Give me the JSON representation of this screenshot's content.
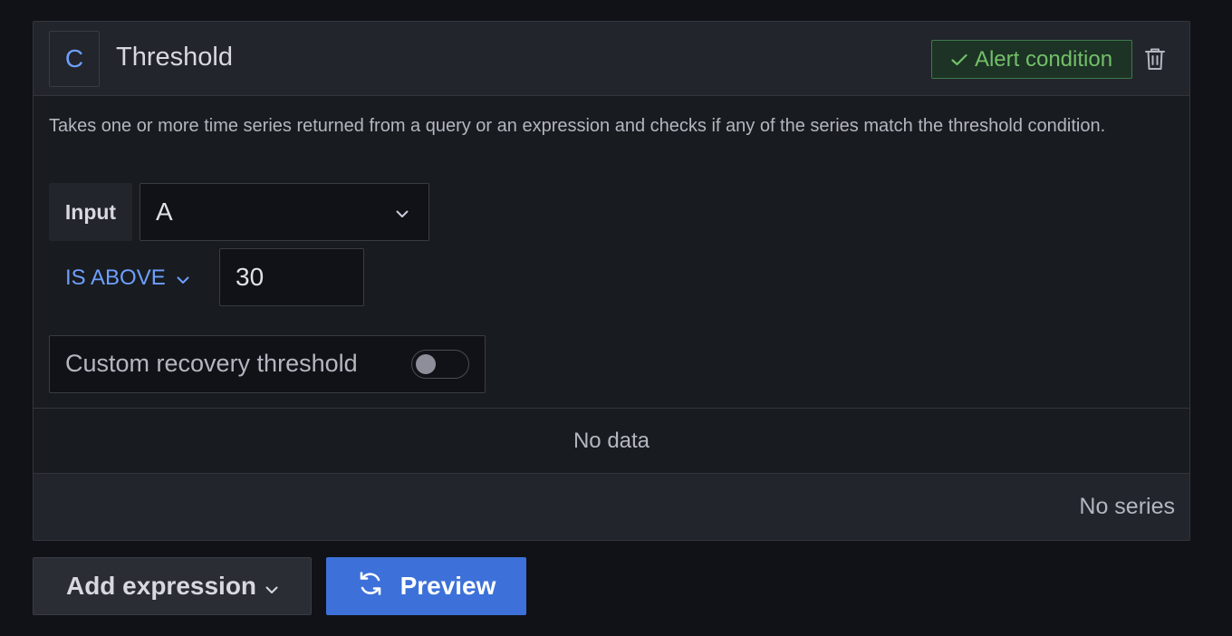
{
  "expression": {
    "ref_id": "C",
    "title": "Threshold",
    "alert_condition_label": "Alert condition",
    "description": "Takes one or more time series returned from a query or an expression and checks if any of the series match the threshold condition.",
    "input_label": "Input",
    "input_value": "A",
    "operator_label": "IS ABOVE",
    "threshold_value": "30",
    "custom_recovery_label": "Custom recovery threshold",
    "custom_recovery_enabled": false
  },
  "results": {
    "no_data_text": "No data",
    "no_series_text": "No series"
  },
  "actions": {
    "add_expression_label": "Add expression",
    "preview_label": "Preview"
  },
  "icons": {
    "check": "check-icon",
    "trash": "trash-icon",
    "chevron": "chevron-down-icon",
    "refresh": "refresh-icon"
  },
  "colors": {
    "accent_blue": "#6e9fff",
    "primary_button": "#3d71d9",
    "success_green": "#73bf69"
  }
}
